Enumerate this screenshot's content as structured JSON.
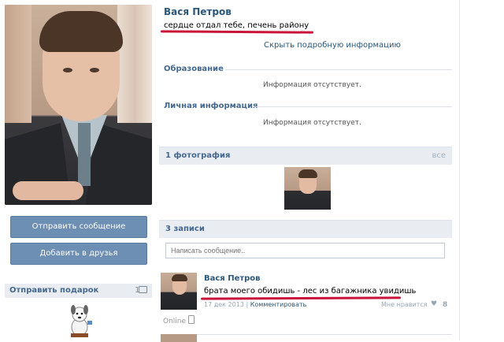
{
  "profile": {
    "name": "Вася Петров",
    "status": "сердце отдал тебе, печень району",
    "hide_info": "Скрыть подробную информацию",
    "sections": [
      {
        "title": "Образование",
        "value": "Информация отсутствует."
      },
      {
        "title": "Личная информация",
        "value": "Информация отсутствует."
      }
    ]
  },
  "actions": {
    "send_message": "Отправить сообщение",
    "add_friend": "Добавить в друзья"
  },
  "gifts": {
    "title": "Отправить подарок",
    "count": "1"
  },
  "photos": {
    "title": "1 фотография",
    "all_link": "все"
  },
  "wall": {
    "title": "3 записи",
    "input_placeholder": "Написать сообщение.."
  },
  "post": {
    "author": "Вася Петров",
    "text": "брата моего обидишь - лес из багажника увидишь",
    "date": "17 дек 2013",
    "separator": "|",
    "comment_link": "Комментировать",
    "like_label": "Мне нравится",
    "likes": "8",
    "online": "Online"
  },
  "colors": {
    "accent": "#2b587a",
    "button": "#6d8fb3",
    "underline": "#c9133a",
    "bar": "#e9edf2"
  }
}
